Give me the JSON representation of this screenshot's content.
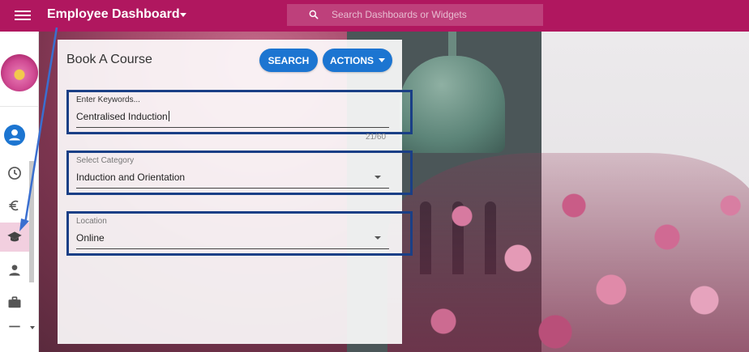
{
  "header": {
    "title": "Employee Dashboard",
    "search_placeholder": "Search Dashboards or Widgets",
    "bar_color": "#b0175f"
  },
  "sidebar": {
    "items": [
      {
        "icon": "account-circle-icon"
      },
      {
        "icon": "clock-icon"
      },
      {
        "icon": "euro-icon"
      },
      {
        "icon": "graduation-cap-icon",
        "active": true
      },
      {
        "icon": "person-icon"
      },
      {
        "icon": "briefcase-icon"
      },
      {
        "icon": "list-icon"
      }
    ]
  },
  "card": {
    "title": "Book A Course",
    "search_button": "SEARCH",
    "actions_button": "ACTIONS",
    "button_color": "#1c75d1",
    "keywords": {
      "label": "Enter Keywords...",
      "value": "Centralised Induction",
      "counter": "21/60"
    },
    "category": {
      "label": "Select Category",
      "value": "Induction and Orientation"
    },
    "location": {
      "label": "Location",
      "value": "Online"
    },
    "highlight_color": "#1a3f86"
  }
}
